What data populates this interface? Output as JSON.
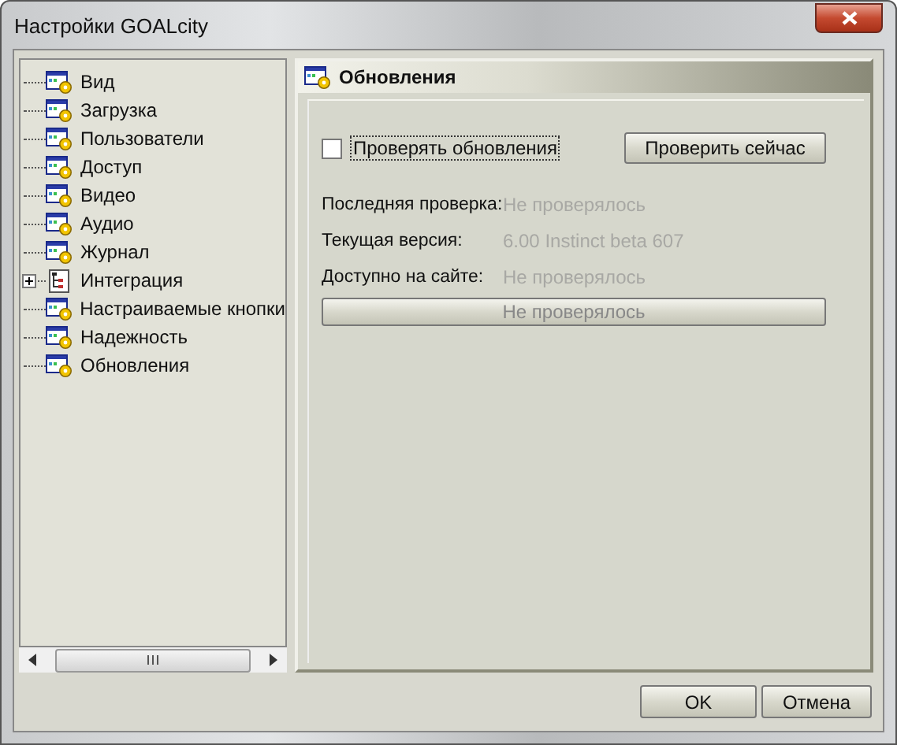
{
  "window": {
    "title": "Настройки GOALcity"
  },
  "tree": {
    "items": [
      {
        "label": "Вид",
        "kind": "settings"
      },
      {
        "label": "Загрузка",
        "kind": "settings"
      },
      {
        "label": "Пользователи",
        "kind": "settings"
      },
      {
        "label": "Доступ",
        "kind": "settings"
      },
      {
        "label": "Видео",
        "kind": "settings"
      },
      {
        "label": "Аудио",
        "kind": "settings"
      },
      {
        "label": "Журнал",
        "kind": "settings"
      },
      {
        "label": "Интеграция",
        "kind": "group",
        "expanded": false
      },
      {
        "label": "Настраиваемые кнопки",
        "kind": "settings"
      },
      {
        "label": "Надежность",
        "kind": "settings"
      },
      {
        "label": "Обновления",
        "kind": "settings"
      }
    ]
  },
  "panel": {
    "title": "Обновления",
    "check_updates": {
      "label": "Проверять обновления",
      "checked": false
    },
    "check_now_button": "Проверить сейчас",
    "info": [
      {
        "label": "Последняя проверка:",
        "value": "Не проверялось"
      },
      {
        "label": "Текущая версия:",
        "value": "6.00 Instinct beta 607"
      },
      {
        "label": "Доступно на сайте:",
        "value": "Не проверялось"
      }
    ],
    "status_button": {
      "label": "Не проверялось",
      "disabled": true
    }
  },
  "buttons": [
    "OK",
    "Отмена"
  ]
}
